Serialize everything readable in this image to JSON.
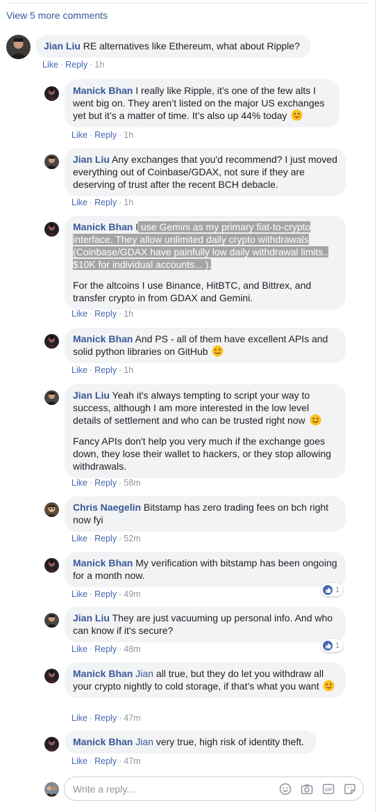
{
  "view_more": "View 5 more comments",
  "actions": {
    "like": "Like",
    "reply": "Reply",
    "sep": "·"
  },
  "comments": [
    {
      "author": "Jian Liu",
      "text": "RE alternatives like Ethereum, what about Ripple?",
      "time": "1h"
    },
    {
      "author": "Manick Bhan",
      "text": "I really like Ripple, it’s one of the few alts I went big on. They aren’t listed on the major US exchanges yet but it’s a matter of time. It’s also up 44% today",
      "emoji": "tongue-out-emoji",
      "time": "1h"
    },
    {
      "author": "Jian Liu",
      "text": "Any exchanges that you'd recommend? I just moved everything out of Coinbase/GDAX, not sure if they are deserving of trust after the recent BCH debacle.",
      "time": "1h"
    },
    {
      "author": "Manick Bhan",
      "text_plain": "I",
      "text_highlight": " use Gemini as my primary fiat-to-crypto interface. They allow unlimited daily crypto withdrawals (Coinbase/GDAX have painfully low daily withdrawal limits.. $10K for individual accounts... ).",
      "text2": "For the altcoins I use Binance, HitBTC, and Bittrex, and transfer crypto in from GDAX and Gemini.",
      "time": "1h"
    },
    {
      "author": "Manick Bhan",
      "text": "And PS - all of them have excellent APIs and solid python libraries on GitHub",
      "emoji": "smile-emoji",
      "time": "1h"
    },
    {
      "author": "Jian Liu",
      "text": "Yeah it's always tempting to script your way to success, although I am more interested in the low level details of settlement and who can be trusted right now",
      "emoji": "smile-emoji",
      "text2": "Fancy APIs don't help you very much if the exchange goes down, they lose their wallet to hackers, or they stop allowing withdrawals.",
      "time": "58m"
    },
    {
      "author": "Chris Naegelin",
      "text": "Bitstamp has zero trading fees on bch right now fyi",
      "time": "52m"
    },
    {
      "author": "Manick Bhan",
      "text": "My verification with bitstamp has been ongoing for a month now.",
      "time": "49m",
      "likes": "1"
    },
    {
      "author": "Jian Liu",
      "text": "They are just vacuuming up personal info. And who can know if it's secure?",
      "time": "48m",
      "likes": "1"
    },
    {
      "author": "Manick Bhan",
      "mention": "Jian",
      "text": "all true, but they do let you withdraw all your crypto nightly to cold storage, if that’s what you want",
      "emoji": "tongue-out-emoji",
      "time": "47m"
    },
    {
      "author": "Manick Bhan",
      "mention": "Jian",
      "text": "very true, high risk of identity theft.",
      "time": "47m"
    }
  ],
  "reply_box": {
    "placeholder": "Write a reply..."
  },
  "colors": {
    "link": "#385898",
    "bubble": "#f2f3f5",
    "meta": "#90949c",
    "like_blue": "#4267b2"
  }
}
